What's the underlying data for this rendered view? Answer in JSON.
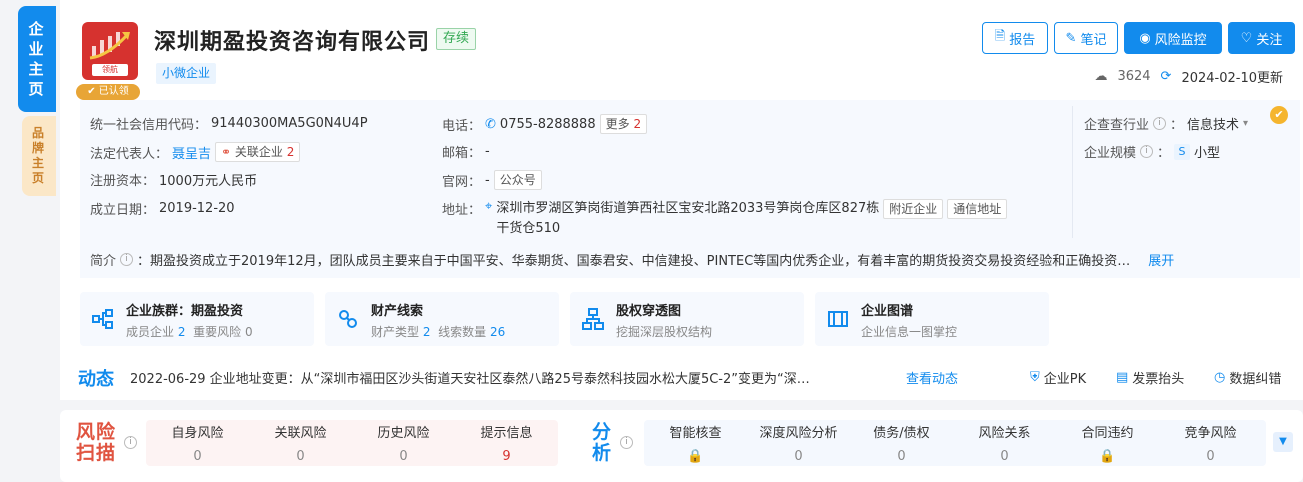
{
  "side_tabs": {
    "main": "企业主页",
    "brand": "品牌主页"
  },
  "company": {
    "name": "深圳期盈投资咨询有限公司",
    "status": "存续",
    "scale_tag": "小微企业",
    "logo_tag": "领航",
    "certified": "已认领"
  },
  "actions": {
    "report": "报告",
    "note": "笔记",
    "monitor": "风险监控",
    "follow": "关注"
  },
  "meta": {
    "views": "3624",
    "updated": "2024-02-10更新"
  },
  "info": {
    "credit_code_label": "统一社会信用代码：",
    "credit_code": "91440300MA5G0N4U4P",
    "legal_rep_label": "法定代表人：",
    "legal_rep": "聂呈吉",
    "related_label": "关联企业",
    "related_count": "2",
    "capital_label": "注册资本：",
    "capital": "1000万元人民币",
    "founded_label": "成立日期：",
    "founded": "2019-12-20",
    "phone_label": "电话：",
    "phone": "0755-8288888",
    "more_label": "更多",
    "more_count": "2",
    "email_label": "邮箱：",
    "email": "-",
    "website_label": "官网：",
    "website": "-",
    "wechat": "公众号",
    "address_label": "地址：",
    "address_line1": "深圳市罗湖区笋岗街道笋西社区宝安北路2033号笋岗仓库区827栋",
    "address_line2": "干货仓510",
    "nearby": "附近企业",
    "mail_addr": "通信地址",
    "industry_label": "企查查行业",
    "industry": "信息技术",
    "size_label": "企业规模",
    "size_badge": "S",
    "size": "小型",
    "intro_label": "简介",
    "intro": "：期盈投资成立于2019年12月，团队成员主要来自于中国平安、华泰期货、国泰君安、中信建投、PINTEC等国内优秀企业，有着丰富的期货投资交易投资经验和正确投资…",
    "expand": "展开"
  },
  "features": [
    {
      "title": "企业族群：期盈投资",
      "s1": "成员企业",
      "v1": "2",
      "s2": "重要风险",
      "v2": "0"
    },
    {
      "title": "财产线索",
      "s1": "财产类型",
      "v1": "2",
      "s2": "线索数量",
      "v2": "26"
    },
    {
      "title": "股权穿透图",
      "sub": "挖掘深层股权结构"
    },
    {
      "title": "企业图谱",
      "sub": "企业信息一图掌控"
    }
  ],
  "dynamic": {
    "title": "动态",
    "text": "2022-06-29 企业地址变更：从“深圳市福田区沙头街道天安社区泰然八路25号泰然科技园水松大厦5C-2”变更为“深…",
    "link": "查看动态",
    "tools": [
      "企业PK",
      "发票抬头",
      "数据纠错"
    ]
  },
  "risk": {
    "title1": "风险",
    "title2": "扫描",
    "items": [
      {
        "label": "自身风险",
        "value": "0"
      },
      {
        "label": "关联风险",
        "value": "0"
      },
      {
        "label": "历史风险",
        "value": "0"
      },
      {
        "label": "提示信息",
        "value": "9"
      }
    ]
  },
  "analysis": {
    "title1": "分",
    "title2": "析",
    "items": [
      {
        "label": "智能核查",
        "value": ""
      },
      {
        "label": "深度风险分析",
        "value": "0"
      },
      {
        "label": "债务/债权",
        "value": "0"
      },
      {
        "label": "风险关系",
        "value": "0"
      },
      {
        "label": "合同违约",
        "value": ""
      },
      {
        "label": "竞争风险",
        "value": "0"
      }
    ]
  },
  "colors": {
    "accent": "#128bed",
    "danger": "#d6322f",
    "success": "#32a852",
    "gold": "#e8a536"
  }
}
